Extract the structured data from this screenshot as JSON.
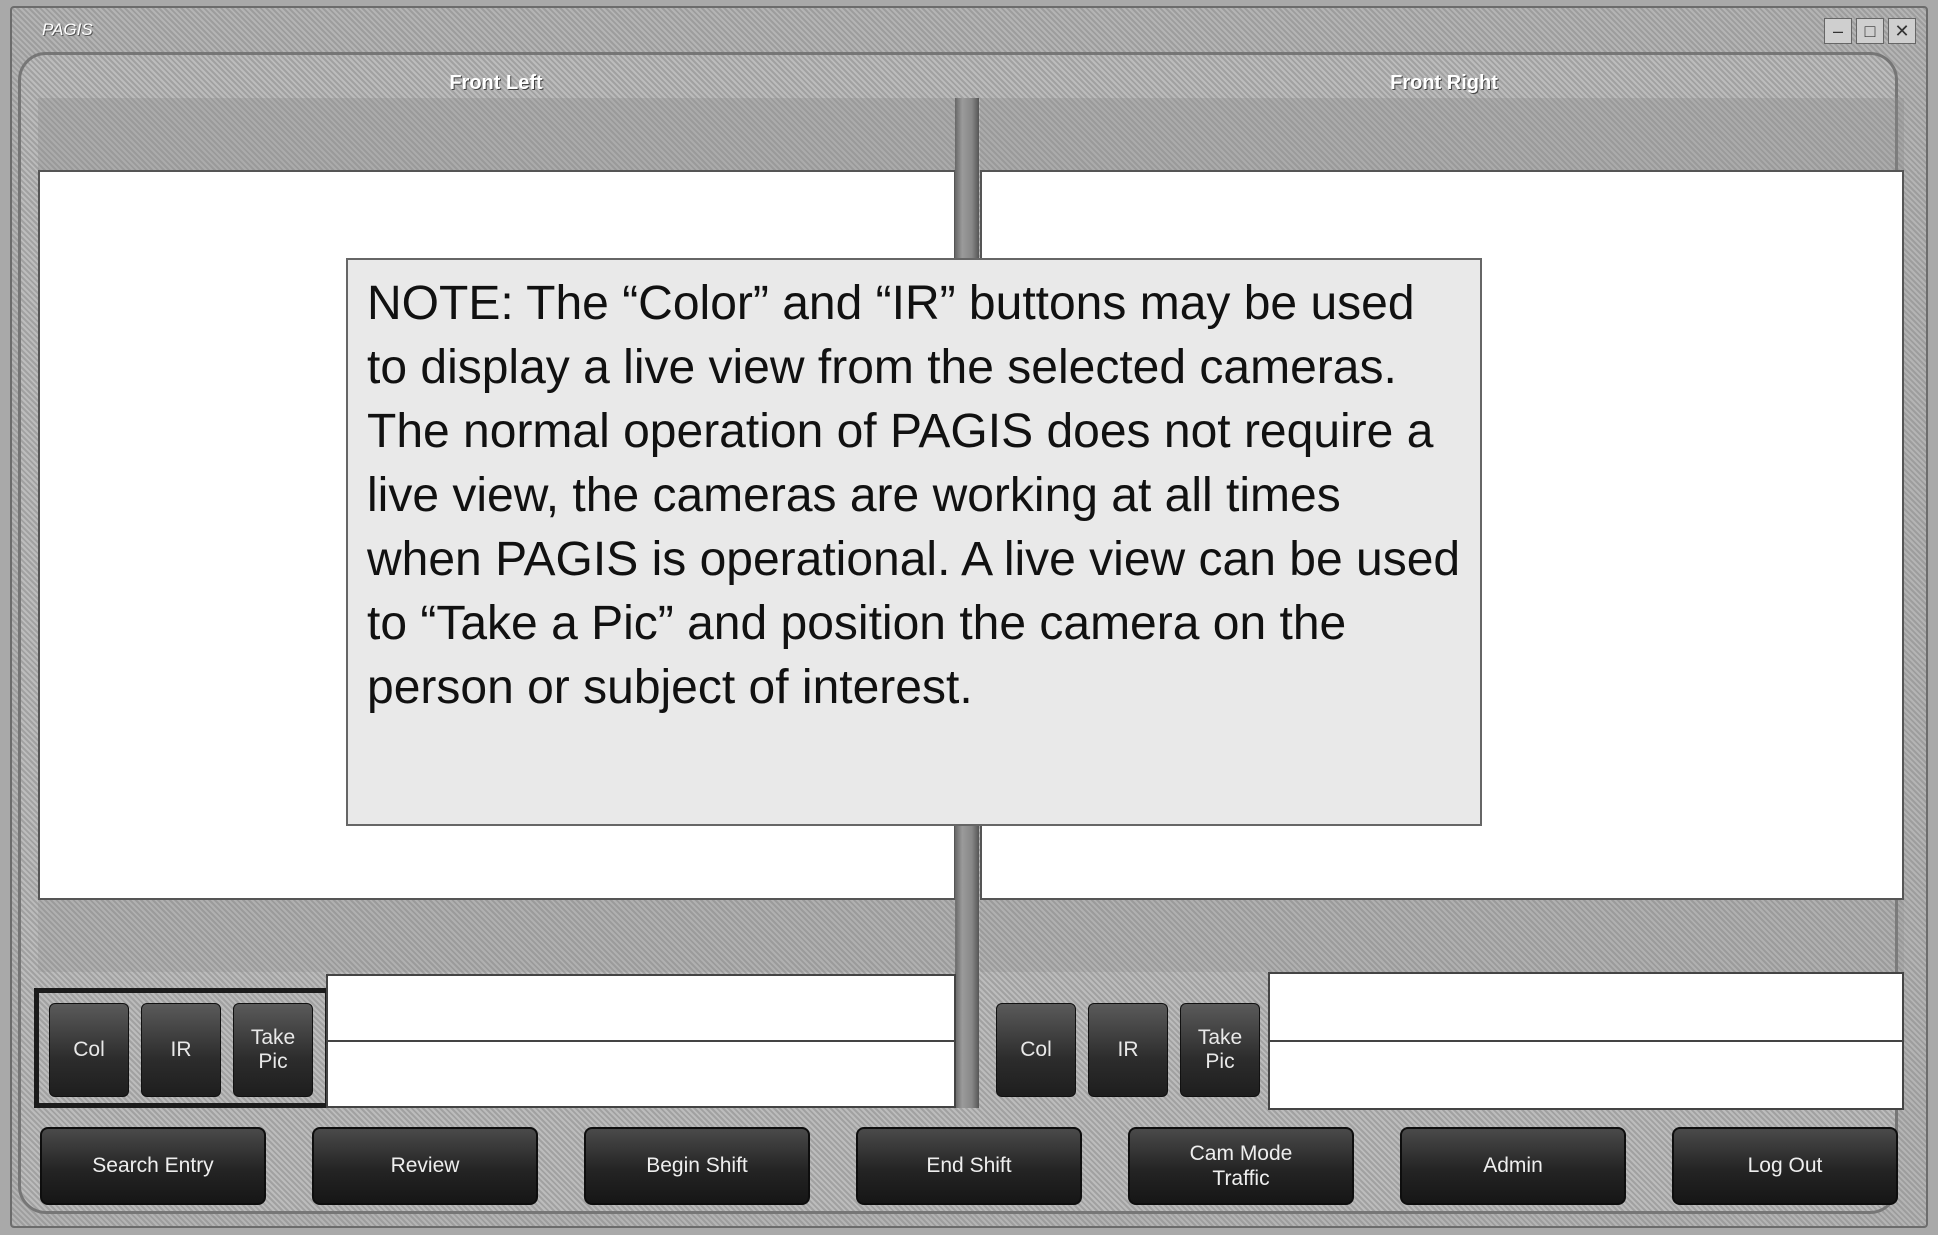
{
  "window": {
    "title": "PAGIS",
    "controls": [
      "minimize",
      "maximize",
      "close"
    ]
  },
  "cameras": {
    "left": {
      "title": "Front Left",
      "buttons": [
        "Col",
        "IR",
        "Take\nPic"
      ]
    },
    "right": {
      "title": "Front Right",
      "buttons": [
        "Col",
        "IR",
        "Take\nPic"
      ]
    }
  },
  "note": {
    "text": "NOTE:  The “Color” and “IR” buttons may be used to display a live view from the selected cameras.  The normal operation of PAGIS does not require a live view,  the cameras are working at all times when PAGIS is operational.   A live view can be used to “Take a Pic” and position the camera on the person or subject of interest."
  },
  "bottom_bar": {
    "buttons": [
      "Search Entry",
      "Review",
      "Begin Shift",
      "End Shift",
      "Cam Mode\nTraffic",
      "Admin",
      "Log Out"
    ]
  },
  "colors": {
    "button_dark": "#242424",
    "frame_gray": "#b4b4b4",
    "viewport_bg": "#ffffff"
  }
}
